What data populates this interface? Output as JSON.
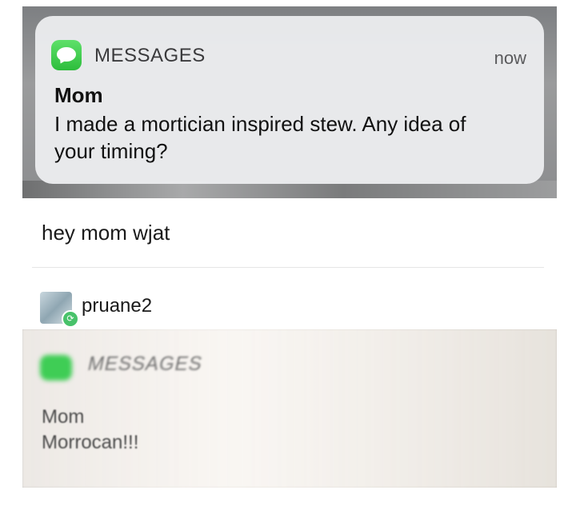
{
  "notification_1": {
    "app_name": "MESSAGES",
    "time": "now",
    "sender": "Mom",
    "body": "I made a mortician inspired stew. Any idea of your timing?"
  },
  "post": {
    "text": "hey  mom wjat",
    "username": "pruane2",
    "reblog_icon": "reblog-icon"
  },
  "notification_2": {
    "app_name": "MESSAGES",
    "sender": "Mom",
    "body": "Morrocan!!!"
  },
  "colors": {
    "messages_green": "#2dbd3c",
    "reblog_green": "#48c26a"
  }
}
